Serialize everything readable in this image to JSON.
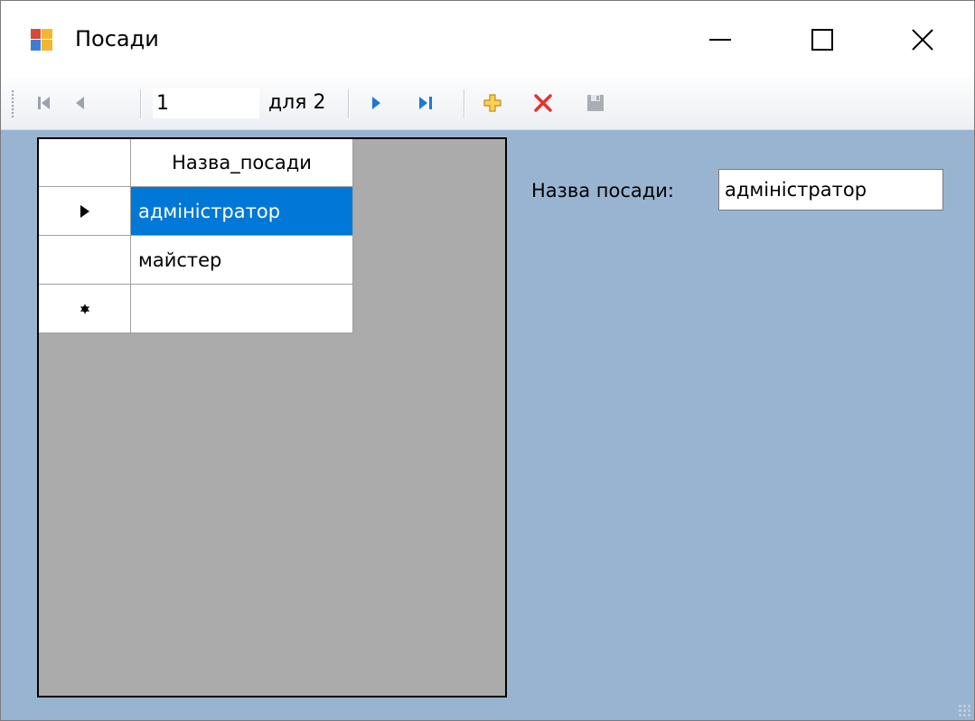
{
  "window": {
    "title": "Посади"
  },
  "navigator": {
    "position": "1",
    "count_label": "для 2"
  },
  "grid": {
    "column_header": "Назва_посади",
    "rows": [
      {
        "value": "адміністратор",
        "selected": true
      },
      {
        "value": "майстер",
        "selected": false
      },
      {
        "value": "",
        "new_row": true
      }
    ]
  },
  "detail": {
    "label": "Назва посади:",
    "value": "адміністратор"
  },
  "colors": {
    "form_background": "#99b4d1",
    "selection": "#0078d7",
    "grid_background": "#ababab"
  }
}
